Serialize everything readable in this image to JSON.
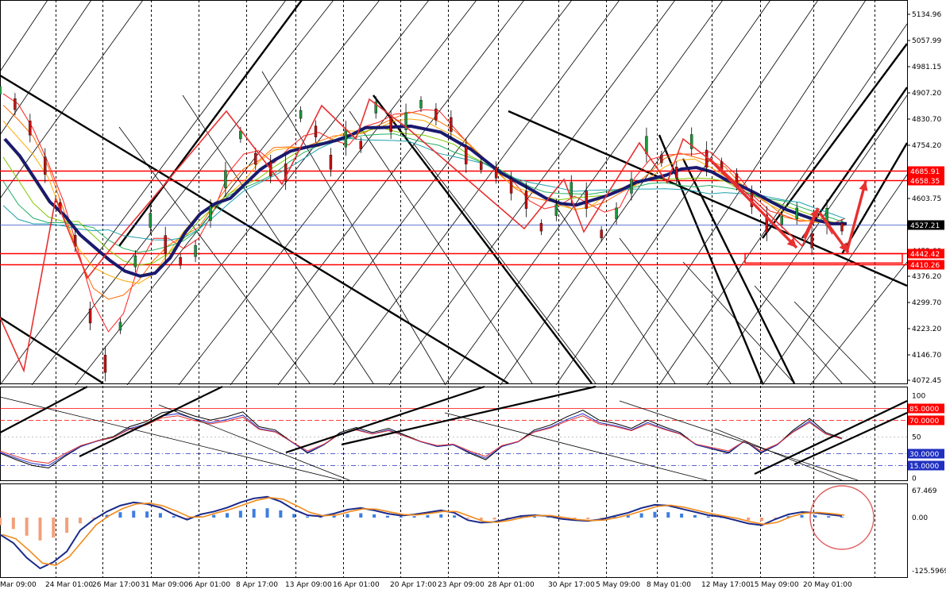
{
  "colors": {
    "price_bars": "#000000",
    "band_high": "#ff0000",
    "ma_thick": "#1a1a6e",
    "signal_red": "#e83030",
    "grid": "#000000",
    "hist_pos": "#3d7ee0",
    "hist_neg": "#f2a07a",
    "macd_line": "#1a2a8a",
    "signal_line": "#f28a1a",
    "rsi_blue": "#2030c0",
    "rsi_red": "#e03030",
    "marker_circle": "#e06060"
  },
  "chart_data": [
    {
      "type": "line",
      "name": "price-panel",
      "title": "",
      "ylim": [
        4072.45,
        5134.96
      ],
      "y_ticks": [
        "5134.96",
        "5057.99",
        "4981.15",
        "4907.20",
        "4830.70",
        "4754.20",
        "4680.24",
        "4603.75",
        "4527.21",
        "4452.60",
        "4376.20",
        "4299.70",
        "4223.20",
        "4146.70",
        "4072.45"
      ],
      "x_labels": [
        "Mar 09:00",
        "24 Mar 01:00",
        "26 Mar 17:00",
        "31 Mar 09:00",
        "6 Apr 01:00",
        "8 Apr 17:00",
        "13 Apr 09:00",
        "16 Apr 01:00",
        "20 Apr 17:00",
        "23 Apr 09:00",
        "28 Apr 01:00",
        "30 Apr 17:00",
        "5 May 09:00",
        "8 May 01:00",
        "12 May 17:00",
        "15 May 09:00",
        "20 May 01:00"
      ],
      "levels": [
        {
          "label": "4685.91",
          "value": 4685.91,
          "style": "red-box"
        },
        {
          "label": "4658.35",
          "value": 4658.35,
          "style": "red-box"
        },
        {
          "label": "4527.21",
          "value": 4527.21,
          "style": "black-box"
        },
        {
          "label": "4442.42",
          "value": 4442.42,
          "style": "red-box"
        },
        {
          "label": "4410.26",
          "value": 4410.26,
          "style": "red-box"
        }
      ],
      "series": [
        {
          "values": [
            4920,
            4880,
            4810,
            4700,
            4580,
            4480,
            4260,
            4120,
            4230,
            4420,
            4540,
            4470,
            4420,
            4450,
            4560,
            4660,
            4790,
            4720,
            4690,
            4680,
            4850,
            4800,
            4710,
            4780,
            4760,
            4870,
            4820,
            4830,
            4880,
            4850,
            4820,
            4730,
            4700,
            4680,
            4640,
            4600,
            4520,
            4570,
            4630,
            4600,
            4500,
            4560,
            4640,
            4760,
            4720,
            4680,
            4770,
            4720,
            4700,
            4660,
            4600,
            4530,
            4540,
            4560,
            4480,
            4550,
            4520
          ]
        }
      ]
    },
    {
      "type": "line",
      "name": "oscillator-panel",
      "title": "",
      "ylim": [
        0,
        100
      ],
      "y_ticks": [
        "100",
        "85.0000",
        "70.0000",
        "50",
        "30.0000",
        "15.0000",
        "0"
      ],
      "series": [
        {
          "values": [
            30,
            22,
            15,
            12,
            26,
            38,
            45,
            50,
            62,
            68,
            79,
            82,
            75,
            70,
            74,
            80,
            62,
            58,
            44,
            30,
            40,
            55,
            61,
            55,
            60,
            52,
            44,
            38,
            40,
            30,
            22,
            38,
            44,
            58,
            64,
            74,
            82,
            70,
            66,
            60,
            70,
            62,
            55,
            40,
            35,
            30,
            45,
            30,
            40,
            58,
            72,
            55,
            48
          ]
        }
      ]
    },
    {
      "type": "bar",
      "name": "macd-panel",
      "title": "",
      "ylim": [
        -125.5969,
        67.469
      ],
      "y_ticks": [
        "67.469",
        "0.00",
        "-125.5969"
      ],
      "series": [
        {
          "values": [
            -40,
            -60,
            -95,
            -120,
            -105,
            -80,
            -30,
            -5,
            15,
            30,
            38,
            34,
            25,
            8,
            -5,
            8,
            15,
            25,
            38,
            48,
            52,
            40,
            20,
            6,
            3,
            10,
            20,
            24,
            18,
            10,
            5,
            8,
            13,
            18,
            12,
            -6,
            -12,
            -10,
            -3,
            4,
            6,
            4,
            -3,
            -6,
            -8,
            -4,
            4,
            12,
            24,
            32,
            30,
            22,
            14,
            6,
            2,
            -6,
            -14,
            -18,
            -4,
            8,
            14,
            12,
            8,
            4
          ]
        }
      ]
    }
  ]
}
